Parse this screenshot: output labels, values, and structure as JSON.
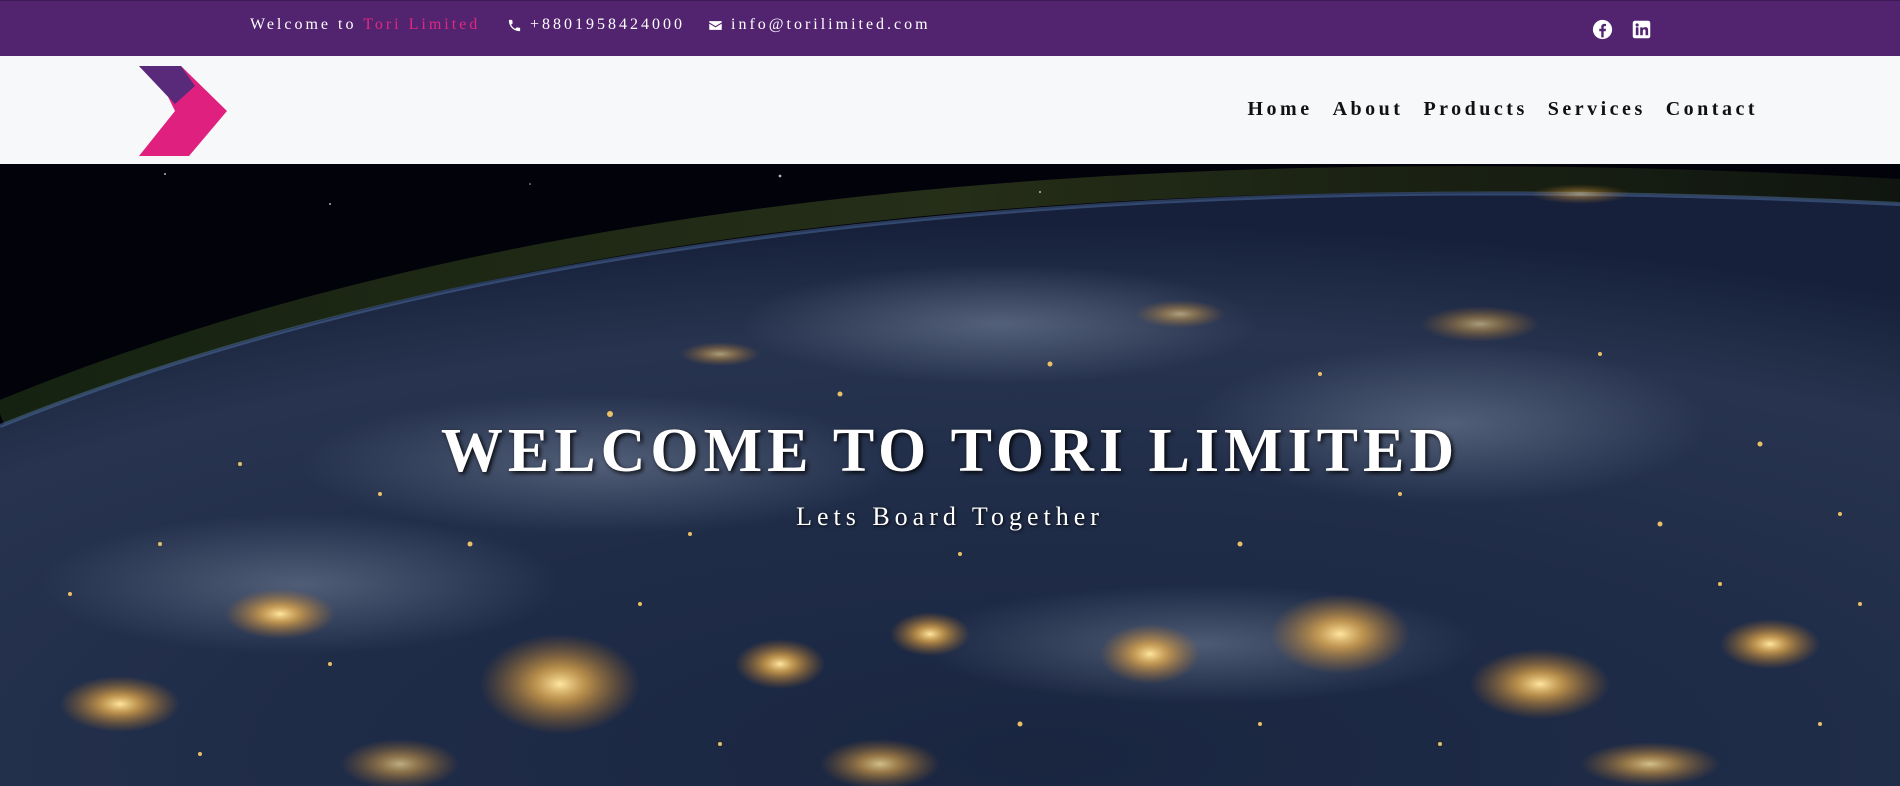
{
  "topbar": {
    "welcome_prefix": "Welcome to",
    "brand_name": "Tori Limited",
    "phone": "+8801958424000",
    "email": "info@torilimited.com",
    "social": [
      {
        "name": "facebook-icon"
      },
      {
        "name": "linkedin-icon"
      }
    ]
  },
  "nav": {
    "items": [
      {
        "label": "Home"
      },
      {
        "label": "About"
      },
      {
        "label": "Products"
      },
      {
        "label": "Services"
      },
      {
        "label": "Contact"
      }
    ]
  },
  "hero": {
    "title": "WELCOME TO TORI LIMITED",
    "subtitle": "Lets Board Together"
  },
  "colors": {
    "topbar_bg": "#52246f",
    "brand_accent": "#e0287f",
    "navbar_bg": "#f7f8fa",
    "logo_purple": "#5a2a7a",
    "logo_pink": "#e0207f"
  },
  "icons": {
    "phone": "phone-icon",
    "email": "envelope-icon",
    "logo": "chevron-logo"
  }
}
